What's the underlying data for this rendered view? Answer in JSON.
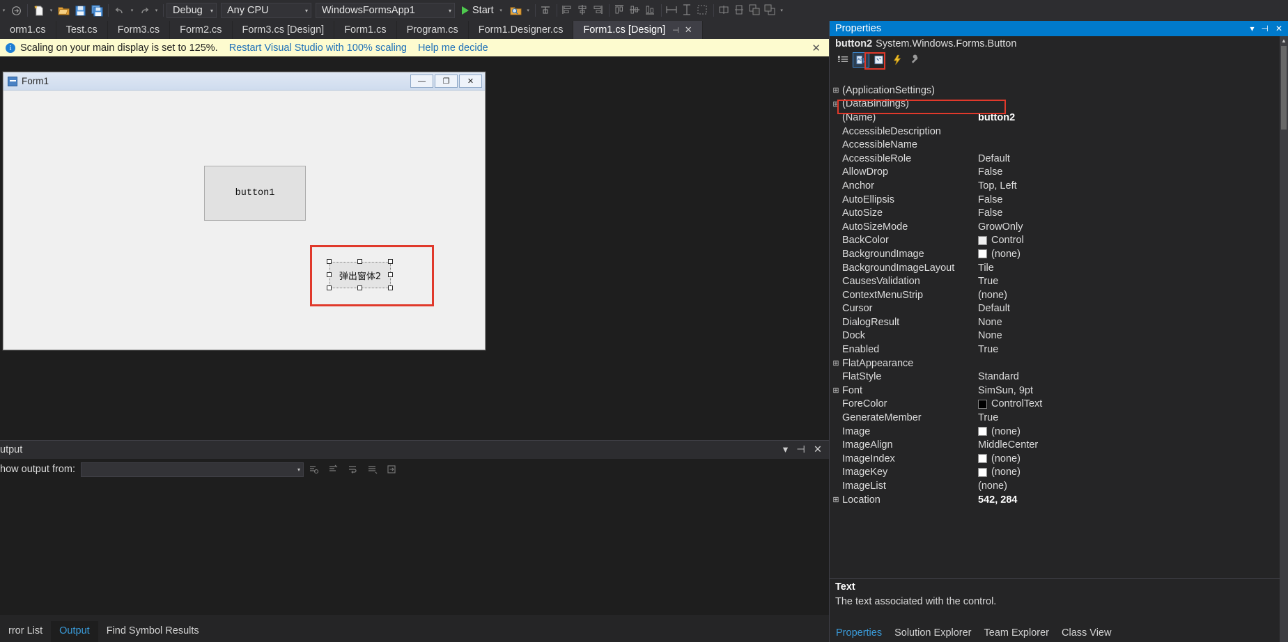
{
  "toolbar": {
    "combo_debug": "Debug",
    "combo_cpu": "Any CPU",
    "combo_project": "WindowsFormsApp1",
    "start_label": "Start",
    "arrow_glyph": "▾"
  },
  "tabs": [
    {
      "label": "orm1.cs",
      "active": false
    },
    {
      "label": "Test.cs",
      "active": false
    },
    {
      "label": "Form3.cs",
      "active": false
    },
    {
      "label": "Form2.cs",
      "active": false
    },
    {
      "label": "Form3.cs [Design]",
      "active": false
    },
    {
      "label": "Form1.cs",
      "active": false
    },
    {
      "label": "Program.cs",
      "active": false
    },
    {
      "label": "Form1.Designer.cs",
      "active": false
    },
    {
      "label": "Form1.cs [Design]",
      "active": true,
      "pin": "⊣",
      "close": "✕"
    }
  ],
  "notification": {
    "text": "Scaling on your main display is set to 125%.",
    "link1": "Restart Visual Studio with 100% scaling",
    "link2": "Help me decide",
    "close": "✕",
    "info_glyph": "i"
  },
  "designer": {
    "form_title": "Form1",
    "min_glyph": "—",
    "max_glyph": "❐",
    "close_glyph": "✕",
    "button1_text": "button1",
    "button2_text": "弹出窗体2"
  },
  "output": {
    "panel_title": "utput",
    "show_output_from_label": "how output from:",
    "combo_value": "",
    "arrow_glyph": "▾",
    "pin_glyph": "⊣",
    "close_glyph": "✕",
    "dropdown_glyph": "▾"
  },
  "bottom_tabs": [
    {
      "label": "rror List",
      "active": false
    },
    {
      "label": "Output",
      "active": true
    },
    {
      "label": "Find Symbol Results",
      "active": false
    }
  ],
  "properties": {
    "title": "Properties",
    "minimize_glyph": "▾",
    "pin_glyph": "⊣",
    "close_glyph": "✕",
    "object_name": "button2",
    "object_class": "System.Windows.Forms.Button",
    "description_title": "Text",
    "description_text": "The text associated with the control.",
    "rows": [
      {
        "expander": "⊞",
        "name": "(ApplicationSettings)",
        "value": "",
        "bold": false
      },
      {
        "expander": "⊞",
        "name": "(DataBindings)",
        "value": "",
        "bold": false
      },
      {
        "expander": "",
        "name": "(Name)",
        "value": "button2",
        "bold": true
      },
      {
        "expander": "",
        "name": "AccessibleDescription",
        "value": "",
        "bold": false
      },
      {
        "expander": "",
        "name": "AccessibleName",
        "value": "",
        "bold": false
      },
      {
        "expander": "",
        "name": "AccessibleRole",
        "value": "Default",
        "bold": false
      },
      {
        "expander": "",
        "name": "AllowDrop",
        "value": "False",
        "bold": false
      },
      {
        "expander": "",
        "name": "Anchor",
        "value": "Top, Left",
        "bold": false
      },
      {
        "expander": "",
        "name": "AutoEllipsis",
        "value": "False",
        "bold": false
      },
      {
        "expander": "",
        "name": "AutoSize",
        "value": "False",
        "bold": false
      },
      {
        "expander": "",
        "name": "AutoSizeMode",
        "value": "GrowOnly",
        "bold": false
      },
      {
        "expander": "",
        "name": "BackColor",
        "value": "Control",
        "bold": false,
        "swatch": "#f0f0f0"
      },
      {
        "expander": "",
        "name": "BackgroundImage",
        "value": "(none)",
        "bold": false,
        "swatch": "#ffffff"
      },
      {
        "expander": "",
        "name": "BackgroundImageLayout",
        "value": "Tile",
        "bold": false
      },
      {
        "expander": "",
        "name": "CausesValidation",
        "value": "True",
        "bold": false
      },
      {
        "expander": "",
        "name": "ContextMenuStrip",
        "value": "(none)",
        "bold": false
      },
      {
        "expander": "",
        "name": "Cursor",
        "value": "Default",
        "bold": false
      },
      {
        "expander": "",
        "name": "DialogResult",
        "value": "None",
        "bold": false
      },
      {
        "expander": "",
        "name": "Dock",
        "value": "None",
        "bold": false
      },
      {
        "expander": "",
        "name": "Enabled",
        "value": "True",
        "bold": false
      },
      {
        "expander": "⊞",
        "name": "FlatAppearance",
        "value": "",
        "bold": false
      },
      {
        "expander": "",
        "name": "FlatStyle",
        "value": "Standard",
        "bold": false
      },
      {
        "expander": "⊞",
        "name": "Font",
        "value": "SimSun, 9pt",
        "bold": false
      },
      {
        "expander": "",
        "name": "ForeColor",
        "value": "ControlText",
        "bold": false,
        "swatch": "#000000"
      },
      {
        "expander": "",
        "name": "GenerateMember",
        "value": "True",
        "bold": false
      },
      {
        "expander": "",
        "name": "Image",
        "value": "(none)",
        "bold": false,
        "swatch": "#ffffff"
      },
      {
        "expander": "",
        "name": "ImageAlign",
        "value": "MiddleCenter",
        "bold": false
      },
      {
        "expander": "",
        "name": "ImageIndex",
        "value": "(none)",
        "bold": false,
        "swatch": "#ffffff"
      },
      {
        "expander": "",
        "name": "ImageKey",
        "value": "(none)",
        "bold": false,
        "swatch": "#ffffff"
      },
      {
        "expander": "",
        "name": "ImageList",
        "value": "(none)",
        "bold": false
      },
      {
        "expander": "⊞",
        "name": "Location",
        "value": "542, 284",
        "bold": true
      }
    ],
    "tabs": [
      {
        "label": "Properties",
        "active": true
      },
      {
        "label": "Solution Explorer",
        "active": false
      },
      {
        "label": "Team Explorer",
        "active": false
      },
      {
        "label": "Class View",
        "active": false
      }
    ]
  },
  "colors": {
    "accent": "#007acc",
    "highlight_red": "#e0392b",
    "notification_bg": "#fdfbcf",
    "chrome": "#2d2d30"
  }
}
